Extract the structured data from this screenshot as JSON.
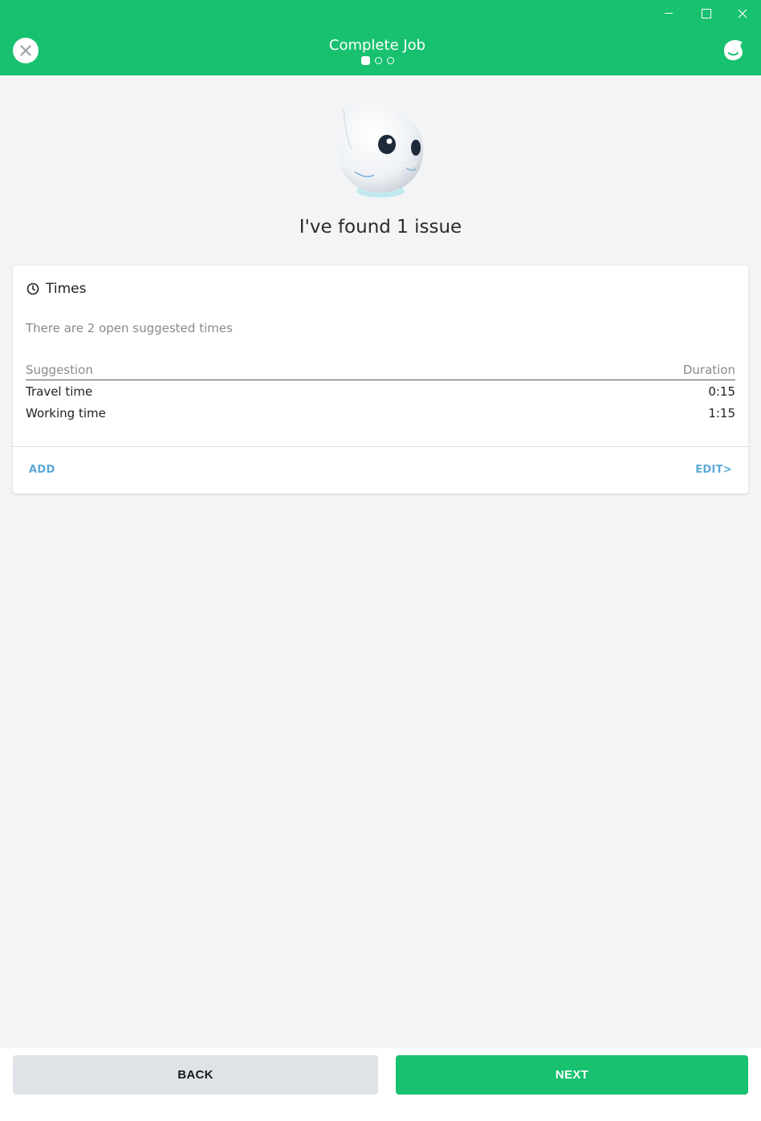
{
  "header": {
    "title": "Complete Job",
    "steps_total": 3,
    "current_step": 1
  },
  "issue_title": "I've found 1 issue",
  "times_card": {
    "title": "Times",
    "subtitle": "There are 2 open suggested times",
    "columns": {
      "suggestion": "Suggestion",
      "duration": "Duration"
    },
    "rows": [
      {
        "label": "Travel time",
        "duration": "0:15"
      },
      {
        "label": "Working time",
        "duration": "1:15"
      }
    ],
    "add_label": "ADD",
    "edit_label": "EDIT>"
  },
  "footer": {
    "back_label": "BACK",
    "next_label": "NEXT"
  },
  "colors": {
    "brand_green": "#17c16f",
    "link_blue": "#5ba8d6",
    "back_button": "#dfe3e7"
  }
}
